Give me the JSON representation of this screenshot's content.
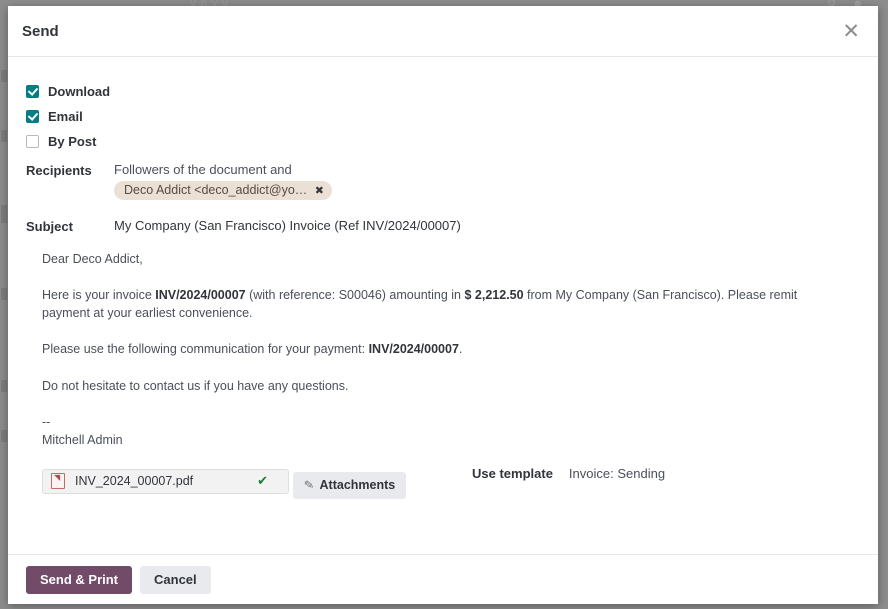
{
  "backdrop": {
    "top_text": "y   p y   y",
    "right_icons": [
      "search-icon",
      "user-avatar"
    ]
  },
  "dialog": {
    "title": "Send",
    "close_label": "✕",
    "options": [
      {
        "label": "Download",
        "checked": true,
        "name": "download"
      },
      {
        "label": "Email",
        "checked": true,
        "name": "email"
      },
      {
        "label": "By Post",
        "checked": false,
        "name": "by-post"
      }
    ],
    "recipients": {
      "label": "Recipients",
      "followers_text": "Followers of the document and",
      "tag": {
        "text": "Deco Addict <deco_addict@you...",
        "remove": "✖"
      }
    },
    "subject": {
      "label": "Subject",
      "value": "My Company (San Francisco) Invoice (Ref INV/2024/00007)"
    },
    "body": {
      "greeting": "Dear Deco Addict,",
      "para1_a": "Here is your invoice ",
      "para1_ref": "INV/2024/00007",
      "para1_b": " (with reference: S00046) amounting in ",
      "para1_amount": "$ 2,212.50",
      "para1_c": " from My Company (San Francisco). Please remit payment at your earliest convenience.",
      "para2_a": "Please use the following communication for your payment: ",
      "para2_ref": "INV/2024/00007",
      "para2_b": ".",
      "para3": "Do not hesitate to contact us if you have any questions.",
      "sig_dashes": "--",
      "sig_name": "Mitchell Admin"
    },
    "attachment": {
      "file_name": "INV_2024_00007.pdf",
      "file_icon": "pdf-file-icon",
      "check_mark": "✔",
      "attachments_button": "Attachments",
      "clip_icon": "✎"
    },
    "template": {
      "label": "Use template",
      "value": "Invoice: Sending"
    },
    "footer": {
      "primary": "Send & Print",
      "secondary": "Cancel"
    }
  },
  "colors": {
    "accent_primary": "#714B67",
    "checkbox_teal": "#017E84",
    "tag_background": "#EBE0D6",
    "text_dark": "#31353B",
    "text_muted": "#4A4F59",
    "check_green": "#1D7A33"
  }
}
